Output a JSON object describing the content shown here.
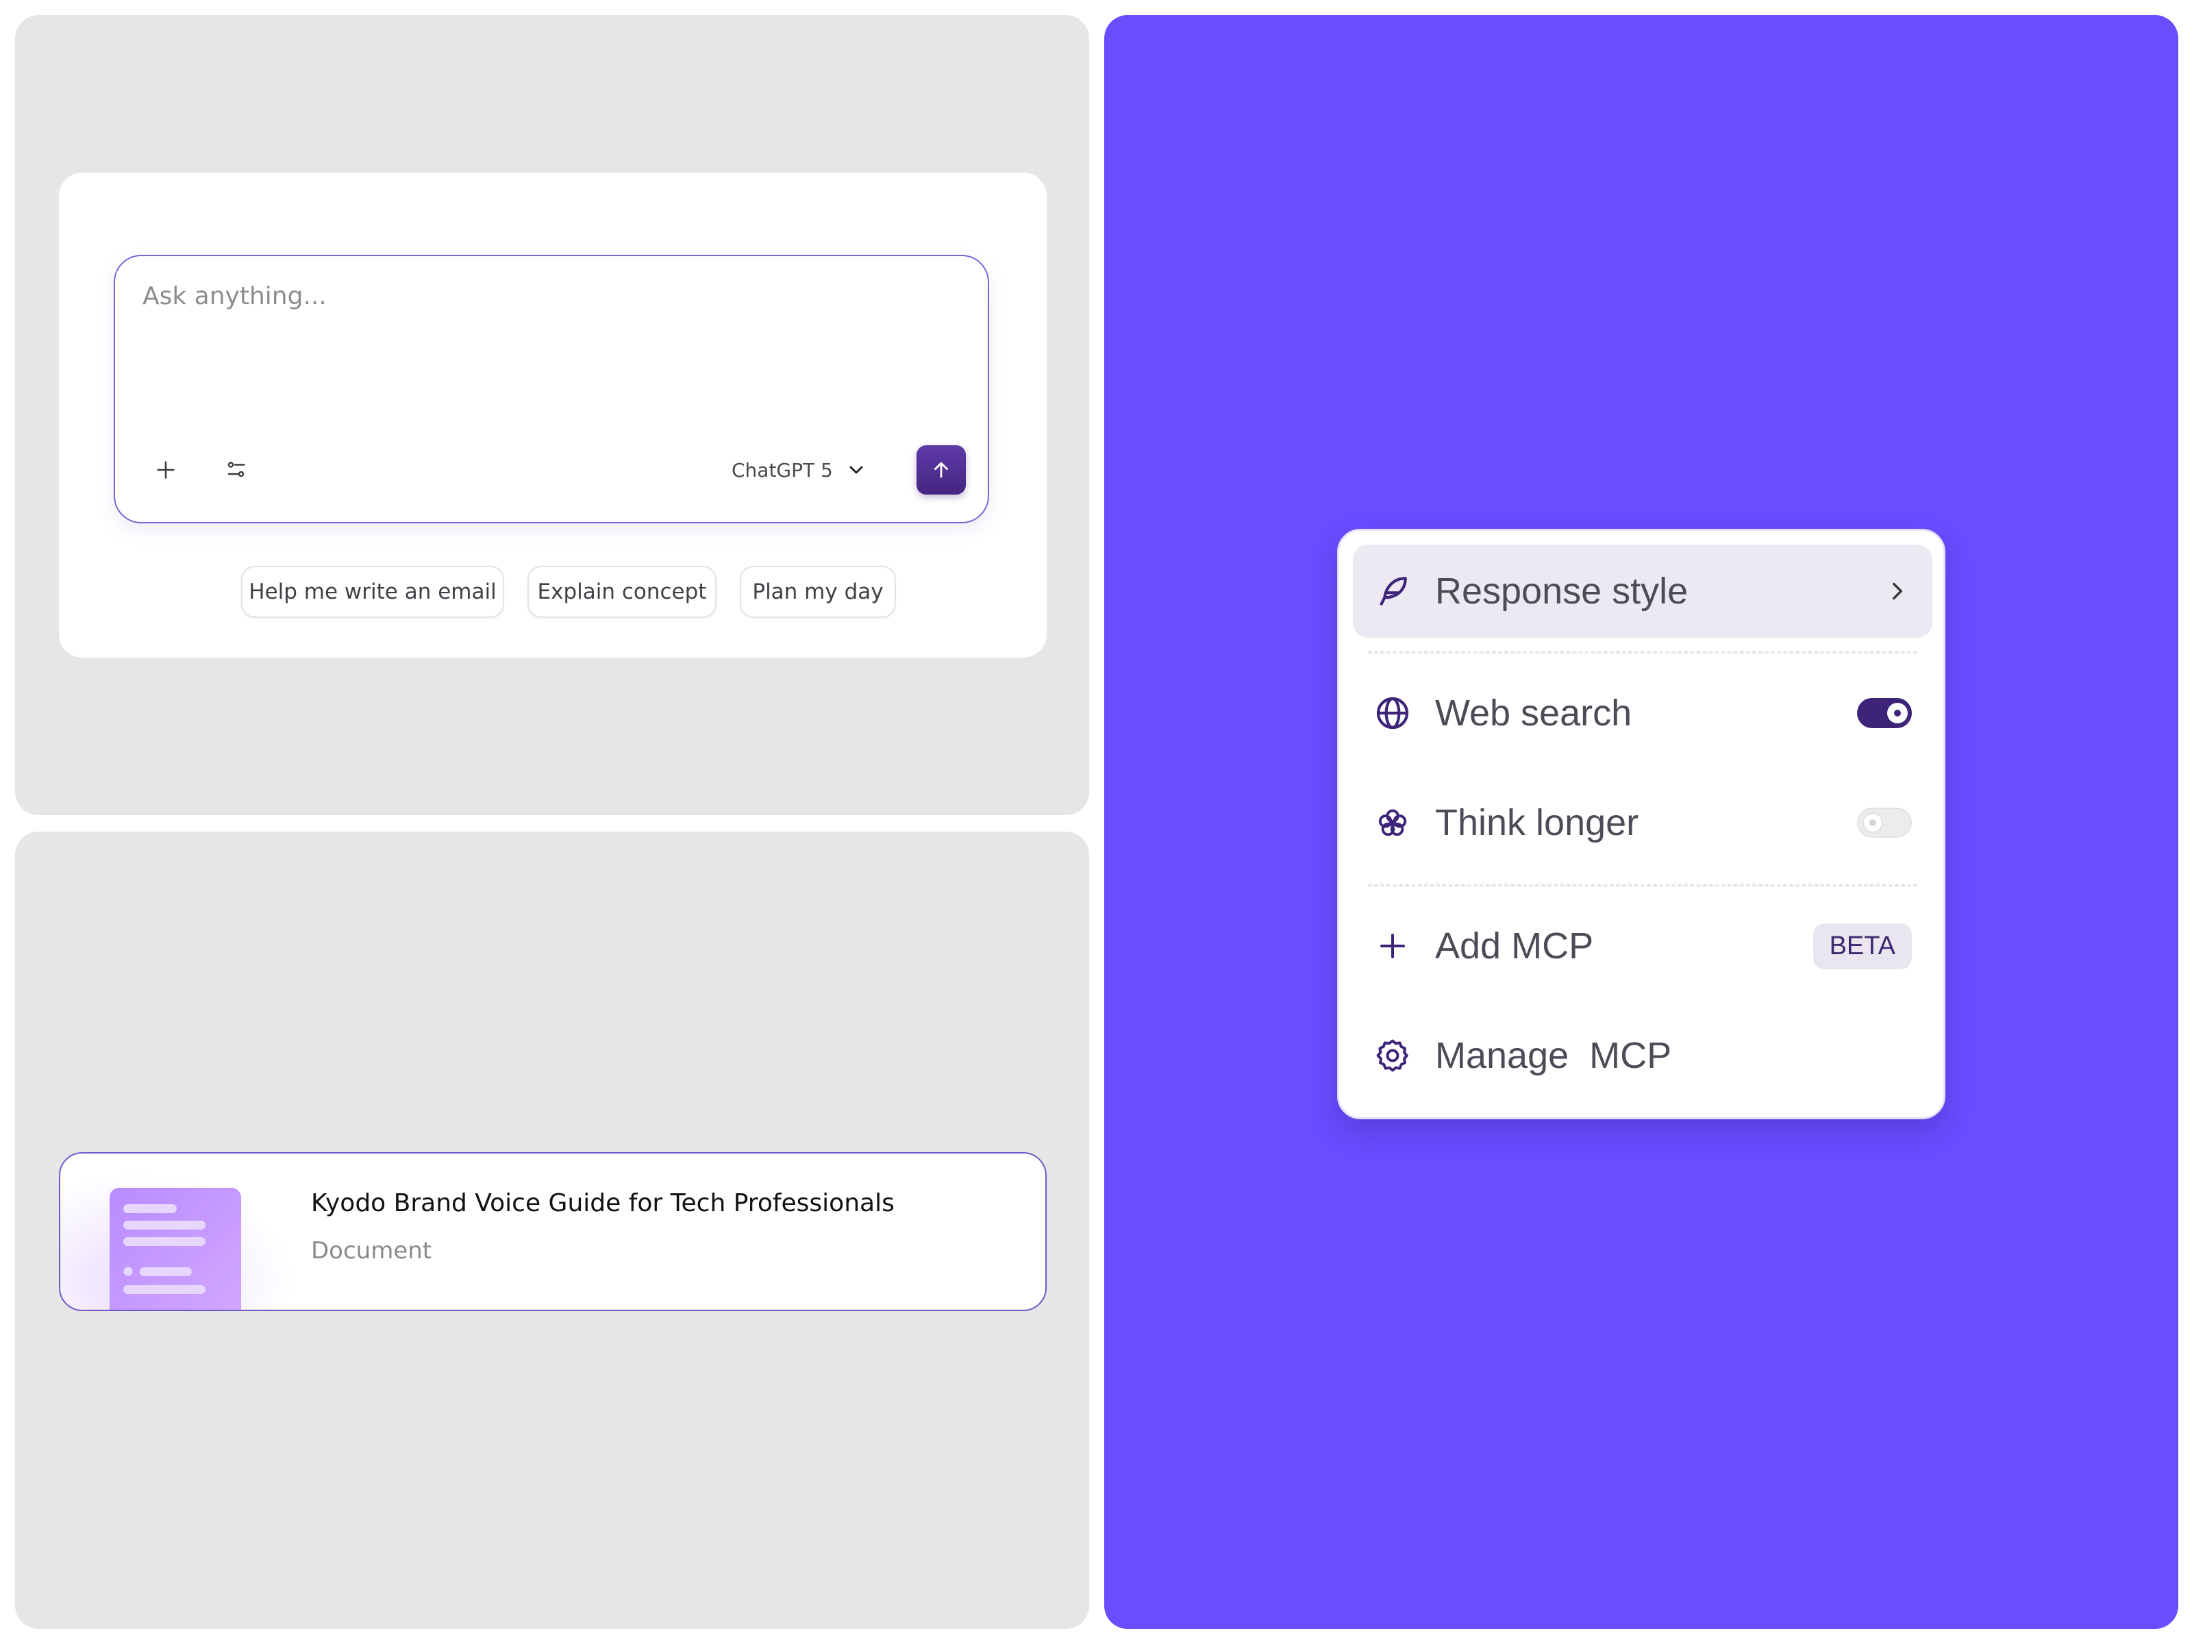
{
  "composer": {
    "placeholder": "Ask anything...",
    "model_label": "ChatGPT 5",
    "icons": {
      "attach": "plus-icon",
      "tools": "sliders-icon",
      "model_dropdown": "chevron-down-icon",
      "send": "arrow-up-icon"
    },
    "suggestions": [
      "Help me write an email",
      "Explain concept",
      "Plan my day"
    ]
  },
  "document_card": {
    "title": "Kyodo Brand Voice Guide for Tech Professionals",
    "type": "Document",
    "icon": "document-thumbnail-icon"
  },
  "options_menu": {
    "items": [
      {
        "label": "Response style",
        "icon": "feather-icon",
        "trailing": "chevron-right-icon"
      },
      {
        "label": "Web search",
        "icon": "globe-icon",
        "toggle": "on"
      },
      {
        "label": "Think longer",
        "icon": "brain-icon",
        "toggle": "off"
      },
      {
        "label": "Add MCP",
        "icon": "plus-icon",
        "badge": "BETA"
      },
      {
        "label": "Manage  MCP",
        "icon": "gear-icon"
      }
    ]
  },
  "colors": {
    "accent": "#6b4cff",
    "primary_dark": "#3e2479",
    "panel_gray": "#e6e6e6"
  }
}
